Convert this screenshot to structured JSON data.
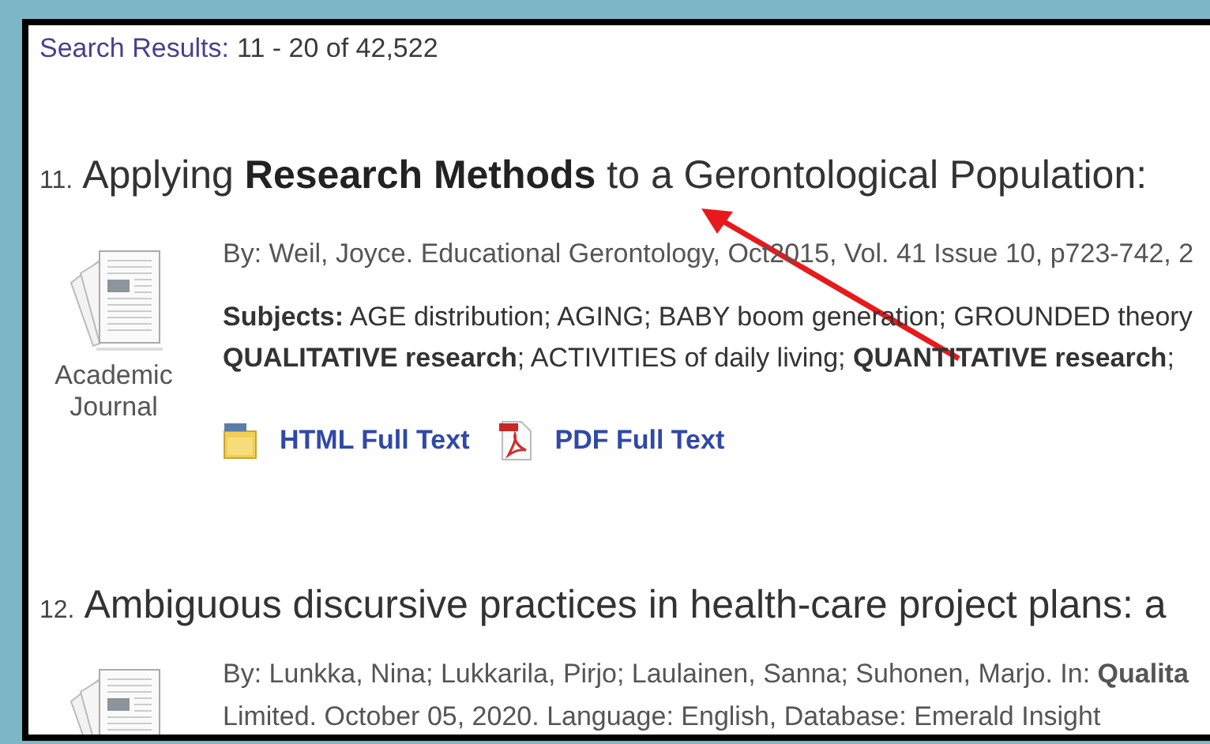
{
  "header": {
    "label": "Search Results:",
    "range": "11 - 20 of 42,522"
  },
  "results": [
    {
      "number": "11.",
      "title": "Applying **Research Methods** to a Gerontological Population:",
      "type": "Academic Journal",
      "byline": [
        "By: Weil, Joyce. Educational Gerontology, Oct2015, Vol. 41 Issue 10, p723-742, 2"
      ],
      "subjects": [
        "**Subjects:** AGE distribution; AGING; BABY boom generation; GROUNDED theory",
        "**QUALITATIVE research**; ACTIVITIES of daily living; **QUANTITATIVE research**;"
      ],
      "links": [
        {
          "kind": "html",
          "label": "HTML Full Text"
        },
        {
          "kind": "pdf",
          "label": "PDF Full Text"
        }
      ]
    },
    {
      "number": "12.",
      "title": "Ambiguous discursive practices in health-care project plans: a",
      "byline": [
        "By: Lunkka, Nina; Lukkarila, Pirjo; Laulainen, Sanna; Suhonen, Marjo. In: **Qualita**",
        "Limited. October 05, 2020. Language: English, Database: Emerald Insight"
      ]
    }
  ]
}
